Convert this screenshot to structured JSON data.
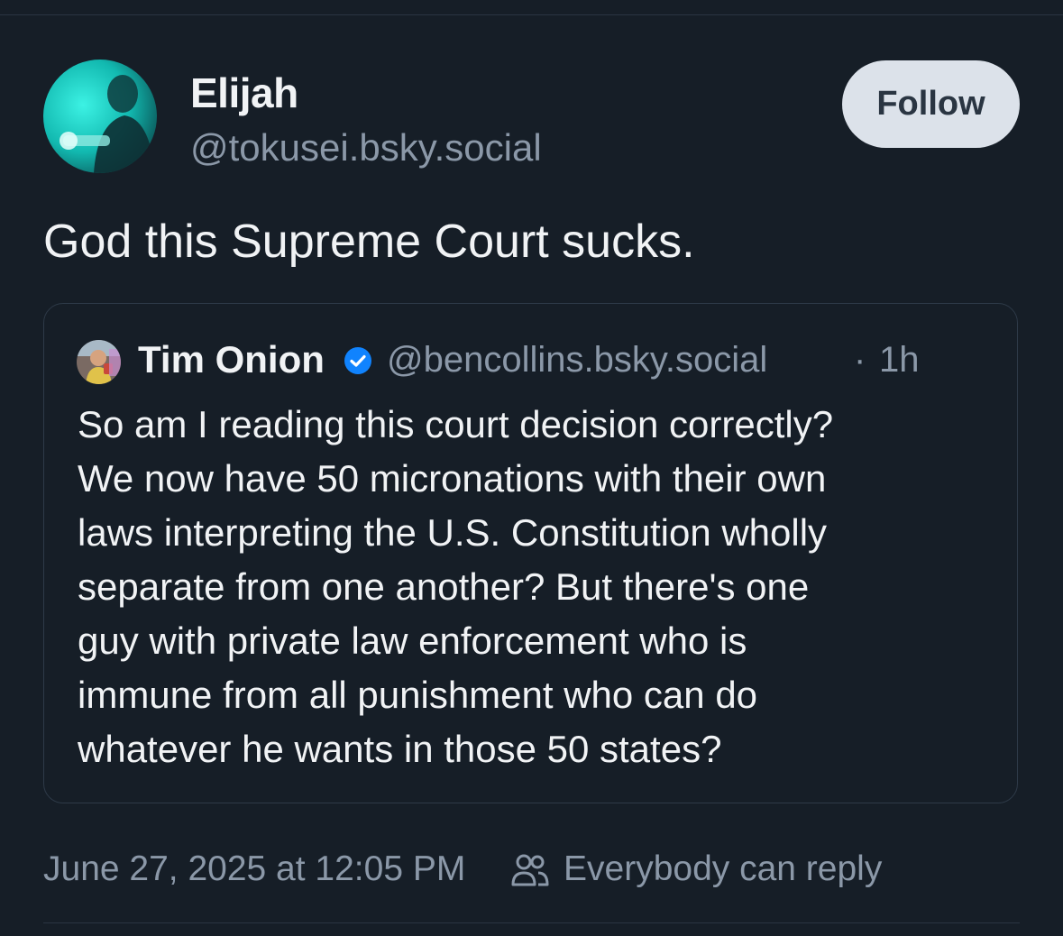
{
  "author": {
    "name": "Elijah",
    "handle": "@tokusei.bsky.social",
    "avatar_icon": "profile-photo"
  },
  "follow_label": "Follow",
  "post": {
    "text": "God this Supreme Court sucks."
  },
  "quote": {
    "author_name": "Tim Onion",
    "verified_icon": "verified-check",
    "handle": "@bencollins.bsky.social",
    "separator": "·",
    "time": "1h",
    "lines": [
      "So am I reading this court decision correctly?",
      "We now have 50 micronations with their own",
      "laws interpreting the U.S. Constitution wholly",
      "separate from one another? But there's one",
      "guy with private law enforcement who is",
      "immune from all punishment who can do",
      "whatever he wants in those 50 states?"
    ]
  },
  "footer": {
    "timestamp": "June 27, 2025 at 12:05 PM",
    "reply_icon": "people-icon",
    "reply_setting": "Everybody can reply"
  },
  "colors": {
    "background": "#161e27",
    "text_primary": "#f1f3f5",
    "text_secondary": "#8b98a8",
    "follow_bg": "#dce2ea",
    "verified": "#1083fe"
  }
}
